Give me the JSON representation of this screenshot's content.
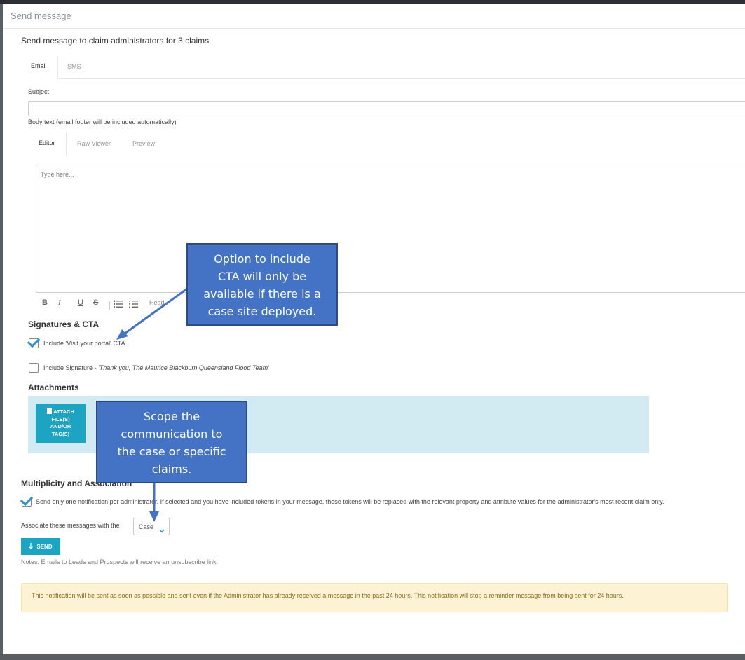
{
  "modal": {
    "title": "Send message",
    "heading": "Send message to claim administrators for 3 claims"
  },
  "channel_tabs": [
    {
      "label": "Email",
      "active": true
    },
    {
      "label": "SMS",
      "active": false
    }
  ],
  "subject": {
    "label": "Subject",
    "value": ""
  },
  "body": {
    "label": "Body text (email footer will be included automatically)",
    "placeholder": "Type here..."
  },
  "editor_tabs": [
    {
      "label": "Editor",
      "active": true
    },
    {
      "label": "Raw Viewer",
      "active": false
    },
    {
      "label": "Preview",
      "active": false
    }
  ],
  "toolbar": {
    "bold": "B",
    "italic": "I",
    "underline": "U",
    "strike": "S",
    "heading": "Head"
  },
  "signatures": {
    "title": "Signatures & CTA",
    "cta_label": "Include 'Visit your portal' CTA",
    "cta_checked": true,
    "signature_label": "Include Signature - ",
    "signature_text": "'Thank you, The Maurice Blackburn Queensland Flood Team'",
    "signature_checked": false
  },
  "attachments": {
    "title": "Attachments",
    "button_lines": [
      "ATTACH",
      "FILE(S)",
      "AND/OR",
      "TAG(S)"
    ]
  },
  "multiplicity": {
    "title": "Multiplicity and Association",
    "checkbox_label": "Send only one notification per administrator. If selected and you have included tokens in your message, these tokens will be replaced with the relevant property and attribute values for the administrator's most recent claim only.",
    "checked": true,
    "associate_label": "Associate these messages with the",
    "associate_value": "Case"
  },
  "send_button": {
    "label": "SEND"
  },
  "notes": "Notes: Emails to Leads and Prospects will receive an unsubscribe link",
  "notice": "This notification will be sent as soon as possible and sent even if the Administrator has already received a message in the past 24 hours. This notification will stop a reminder message from being sent for 24 hours.",
  "callouts": {
    "cta": [
      "Option to include",
      "CTA will only be",
      "available if there is a",
      "case site deployed."
    ],
    "scope": [
      "Scope the",
      "communication to",
      "the case or specific",
      "claims."
    ]
  },
  "colors": {
    "accent": "#1ea4c3",
    "checkbox": "#2e90d1",
    "callout": "#4472c4",
    "notice_bg": "#fdf3d4"
  }
}
